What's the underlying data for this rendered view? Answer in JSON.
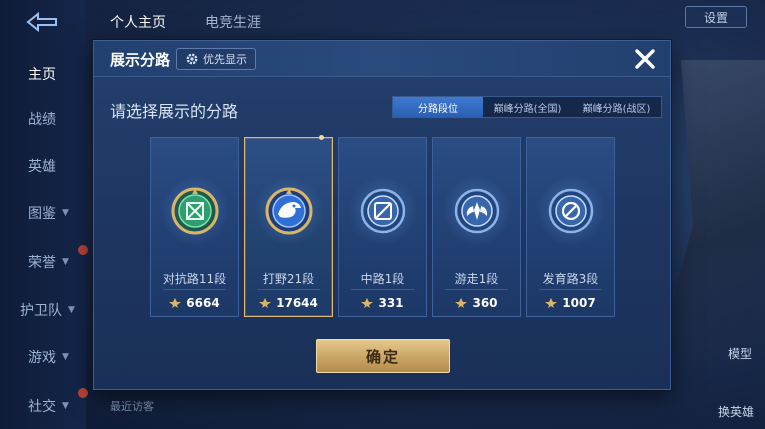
{
  "nav": {
    "items": [
      {
        "label": "主页",
        "active": true,
        "chevron": false
      },
      {
        "label": "战绩",
        "active": false,
        "chevron": false
      },
      {
        "label": "英雄",
        "active": false,
        "chevron": false
      },
      {
        "label": "图鉴",
        "active": false,
        "chevron": true
      },
      {
        "label": "荣誉",
        "active": false,
        "chevron": true
      },
      {
        "label": "护卫队",
        "active": false,
        "chevron": true
      },
      {
        "label": "游戏",
        "active": false,
        "chevron": true
      },
      {
        "label": "社交",
        "active": false,
        "chevron": true
      }
    ]
  },
  "top_tabs": [
    {
      "label": "个人主页"
    },
    {
      "label": "电竞生涯"
    }
  ],
  "settings_label": "设置",
  "side_labels": {
    "model": "模型",
    "change_hero": "换英雄"
  },
  "recent_visitors": "最近访客",
  "modal": {
    "title": "展示分路",
    "priority_button": "优先显示",
    "subtitle": "请选择展示的分路",
    "tabs": [
      {
        "label": "分路段位",
        "active": true
      },
      {
        "label": "巅峰分路(全国)",
        "active": false
      },
      {
        "label": "巅峰分路(战区)",
        "active": false
      }
    ],
    "cards": [
      {
        "rank": "对抗路11段",
        "score": "6664",
        "selected": false,
        "emblem": "crossed-swords-icon",
        "color": "#3fc07a"
      },
      {
        "rank": "打野21段",
        "score": "17644",
        "selected": true,
        "emblem": "dragon-head-icon",
        "color": "#2f6fd6"
      },
      {
        "rank": "中路1段",
        "score": "331",
        "selected": false,
        "emblem": "slash-square-icon",
        "color": "#4c86d8"
      },
      {
        "rank": "游走1段",
        "score": "360",
        "selected": false,
        "emblem": "wings-icon",
        "color": "#4c86d8"
      },
      {
        "rank": "发育路3段",
        "score": "1007",
        "selected": false,
        "emblem": "target-icon",
        "color": "#4c86d8"
      }
    ],
    "confirm_label": "确定"
  },
  "colors": {
    "gold": "#e2b770",
    "modal_bg": "#1d3560",
    "tab_active": "#2a5fb3"
  }
}
